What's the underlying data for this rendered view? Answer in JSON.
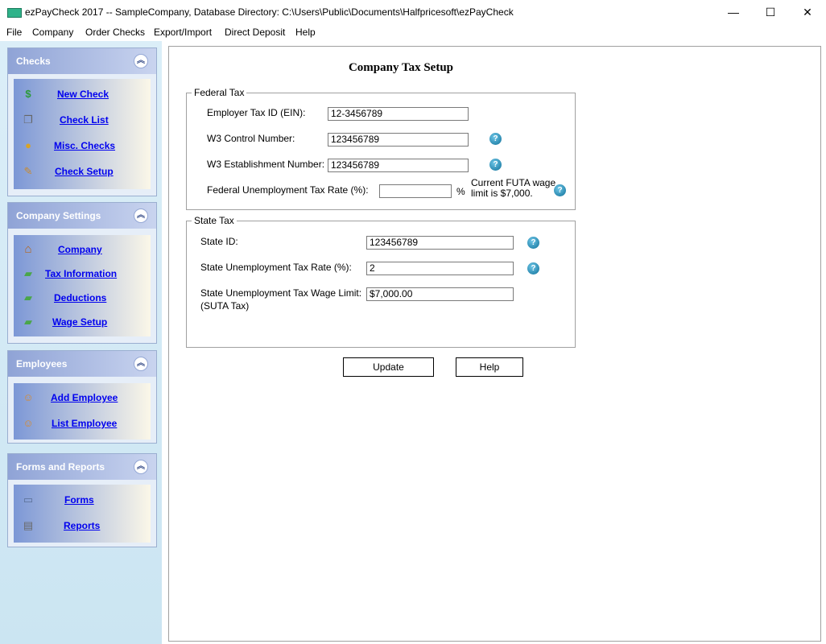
{
  "window": {
    "title": "ezPayCheck 2017 -- SampleCompany, Database Directory: C:\\Users\\Public\\Documents\\Halfpricesoft\\ezPayCheck",
    "minimize": "—",
    "maximize": "☐",
    "close": "✕"
  },
  "menu": [
    "File",
    "Company",
    "Order Checks",
    "Export/Import",
    "Direct Deposit",
    "Help"
  ],
  "sidebar": {
    "checks": {
      "title": "Checks",
      "collapse": "︽",
      "items": [
        {
          "label": "New Check",
          "icon": "dollar-icon",
          "glyph": "$"
        },
        {
          "label": "Check List",
          "icon": "pages-icon",
          "glyph": "❐"
        },
        {
          "label": "Misc. Checks",
          "icon": "money-bag-icon",
          "glyph": "●"
        },
        {
          "label": "Check Setup",
          "icon": "wrench-icon",
          "glyph": "✎"
        }
      ]
    },
    "company": {
      "title": "Company Settings",
      "collapse": "︽",
      "items": [
        {
          "label": "Company",
          "icon": "house-icon",
          "glyph": "⌂"
        },
        {
          "label": "Tax Information",
          "icon": "cash-icon",
          "glyph": "▰"
        },
        {
          "label": "Deductions",
          "icon": "cash-minus-icon",
          "glyph": "▰"
        },
        {
          "label": "Wage Setup",
          "icon": "cash-plus-icon",
          "glyph": "▰"
        }
      ]
    },
    "employees": {
      "title": "Employees",
      "collapse": "︽",
      "items": [
        {
          "label": "Add Employee",
          "icon": "add-people-icon",
          "glyph": "☺"
        },
        {
          "label": "List Employee",
          "icon": "people-icon",
          "glyph": "☺"
        }
      ]
    },
    "forms": {
      "title": "Forms and Reports",
      "collapse": "︽",
      "items": [
        {
          "label": "Forms",
          "icon": "forms-icon",
          "glyph": "▭"
        },
        {
          "label": "Reports",
          "icon": "notebook-icon",
          "glyph": "▤"
        }
      ]
    }
  },
  "main": {
    "title": "Company Tax Setup",
    "federal": {
      "legend": "Federal Tax",
      "ein_label": "Employer Tax ID (EIN):",
      "ein_value": "12-3456789",
      "w3_control_label": "W3 Control Number:",
      "w3_control_value": "123456789",
      "w3_establishment_label": "W3 Establishment Number:",
      "w3_establishment_value": "123456789",
      "futa_label": "Federal Unemployment Tax Rate  (%):",
      "futa_value": "",
      "futa_unit": "%",
      "futa_note_line1": "Current FUTA wage",
      "futa_note_line2": "limit is $7,000."
    },
    "state": {
      "legend": "State Tax",
      "state_id_label": "State ID:",
      "state_id_value": "123456789",
      "suta_rate_label": "State Unemployment Tax Rate  (%):",
      "suta_rate_value": "2",
      "suta_limit_label_line1": "State Unemployment Tax Wage Limit:",
      "suta_limit_label_line2": "(SUTA Tax)",
      "suta_limit_value": "$7,000.00"
    },
    "update_label": "Update",
    "help_label": "Help",
    "help_glyph": "?"
  }
}
